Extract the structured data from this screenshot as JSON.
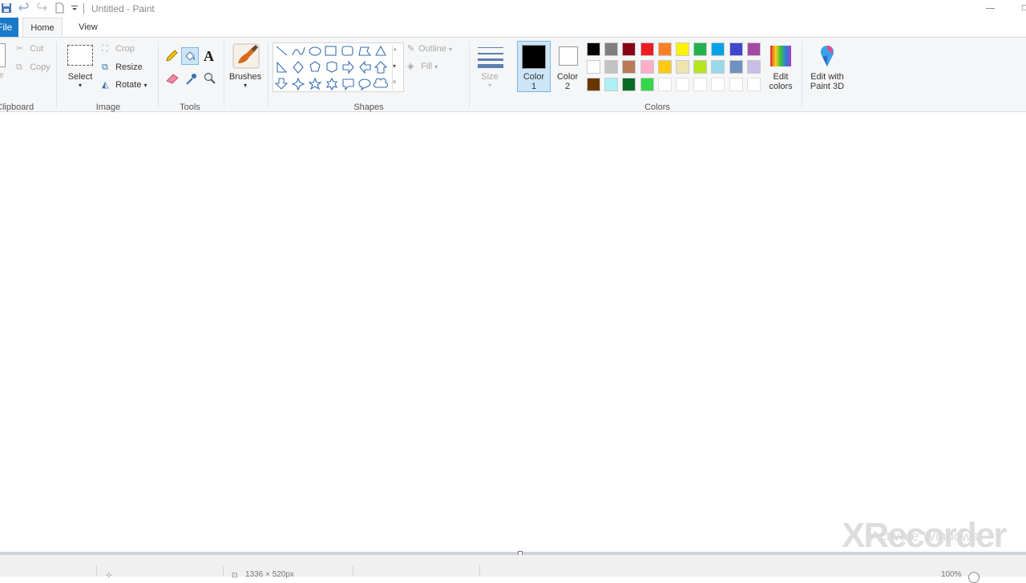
{
  "window": {
    "title": "Untitled - Paint"
  },
  "tabs": {
    "file": "File",
    "home": "Home",
    "view": "View"
  },
  "clipboard": {
    "label": "Clipboard",
    "cut": "Cut",
    "copy": "Copy"
  },
  "image": {
    "label": "Image",
    "select": "Select",
    "crop": "Crop",
    "resize": "Resize",
    "rotate": "Rotate"
  },
  "tools": {
    "label": "Tools"
  },
  "brushes": {
    "label": "Brushes"
  },
  "shapes": {
    "label": "Shapes",
    "outline": "Outline",
    "fill": "Fill"
  },
  "size": {
    "label": "Size"
  },
  "colors": {
    "label": "Colors",
    "color1_line1": "Color",
    "color1_line2": "1",
    "color2_line1": "Color",
    "color2_line2": "2",
    "edit_line1": "Edit",
    "edit_line2": "colors",
    "paint3d_line1": "Edit with",
    "paint3d_line2": "Paint 3D",
    "color1_value": "#000000",
    "color2_value": "#ffffff",
    "palette_row1": [
      "#000000",
      "#7f7f7f",
      "#880015",
      "#ed1c24",
      "#ff7f27",
      "#fff200",
      "#22b14c",
      "#00a2e8",
      "#3f48cc",
      "#a349a4"
    ],
    "palette_row2": [
      "#ffffff",
      "#c3c3c3",
      "#b97a57",
      "#ffaec9",
      "#ffc90e",
      "#efe4b0",
      "#b5e61d",
      "#99d9ea",
      "#7092be",
      "#c8bfe7"
    ],
    "palette_row3": [
      "#6a3600",
      "#aef1f5",
      "#0a6b26",
      "#34d64a",
      "#ffffff",
      "#ffffff",
      "#ffffff",
      "#ffffff",
      "#ffffff",
      "#ffffff"
    ]
  },
  "status": {
    "size_readout": "1336 × 520px",
    "zoom": "100%"
  },
  "watermark": {
    "activate": "Activate Windows",
    "recorder": "XRecorder"
  }
}
